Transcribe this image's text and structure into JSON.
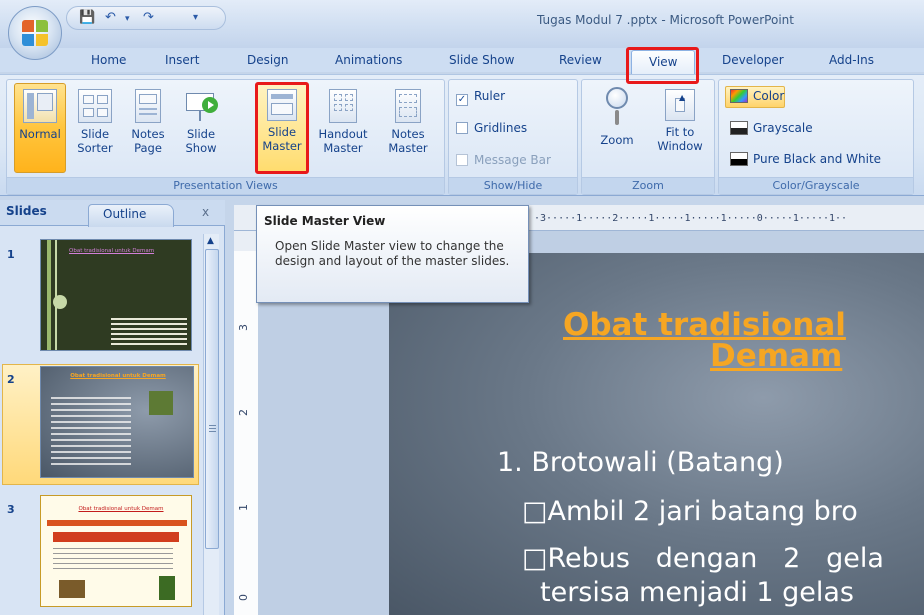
{
  "window": {
    "title": "Tugas Modul 7 .pptx - Microsoft PowerPoint"
  },
  "tabs": [
    "Home",
    "Insert",
    "Design",
    "Animations",
    "Slide Show",
    "Review",
    "View",
    "Developer",
    "Add-Ins"
  ],
  "active_tab": "View",
  "ribbon": {
    "presentation_views": {
      "label": "Presentation Views",
      "buttons": [
        {
          "line1": "Normal",
          "line2": ""
        },
        {
          "line1": "Slide",
          "line2": "Sorter"
        },
        {
          "line1": "Notes",
          "line2": "Page"
        },
        {
          "line1": "Slide",
          "line2": "Show"
        },
        {
          "line1": "Slide",
          "line2": "Master"
        },
        {
          "line1": "Handout",
          "line2": "Master"
        },
        {
          "line1": "Notes",
          "line2": "Master"
        }
      ]
    },
    "show_hide": {
      "label": "Show/Hide",
      "ruler": "Ruler",
      "gridlines": "Gridlines",
      "message_bar": "Message Bar",
      "ruler_checked": true,
      "gridlines_checked": false,
      "message_bar_checked": false
    },
    "zoom": {
      "label": "Zoom",
      "zoom_button": "Zoom",
      "fit_line1": "Fit to",
      "fit_line2": "Window"
    },
    "color_grayscale": {
      "label": "Color/Grayscale",
      "color": "Color",
      "grayscale": "Grayscale",
      "pure": "Pure Black and White"
    }
  },
  "slides_pane": {
    "tab_slides": "Slides",
    "tab_outline": "Outline",
    "close": "x",
    "slide_numbers": [
      "1",
      "2",
      "3"
    ],
    "thumb1_title": "Obat tradisional untuk Demam",
    "thumb2_title": "Obat tradisional untuk Demam",
    "thumb3_title": "Obat tradisional untuk Demam"
  },
  "ruler": {
    "h_text": "·3·····1·····2·····1·····1·····1·····0·····1·····1··",
    "v_labels": [
      "3",
      "2",
      "1",
      "0"
    ]
  },
  "tooltip": {
    "title": "Slide Master View",
    "body": "Open Slide Master view to change the design and layout of the master slides."
  },
  "slide": {
    "title_line1": "Obat tradisional",
    "title_line2": "Demam",
    "point1": "1. Brotowali (Batang)",
    "bullet1": "□Ambil 2 jari batang bro",
    "bullet2": "□Rebus   dengan   2   gela",
    "bullet3": "tersisa menjadi 1 gelas"
  },
  "colors": {
    "accent_highlight": "#e8191a",
    "slide_title": "#f6a623",
    "ribbon_bg": "#dbe7f5"
  }
}
